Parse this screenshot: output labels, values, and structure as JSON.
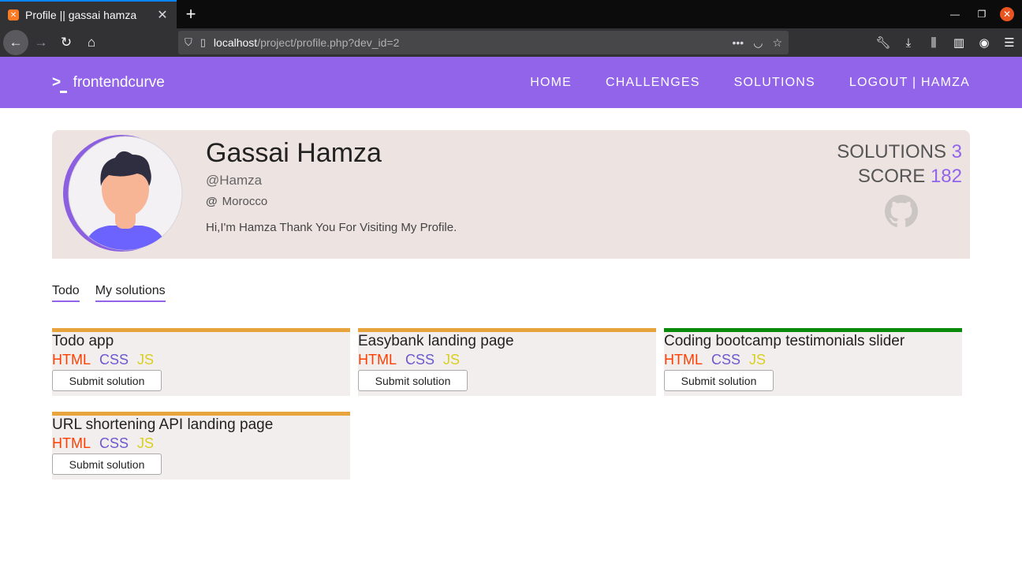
{
  "browser": {
    "tab_title": "Profile || gassai hamza",
    "url_host": "localhost",
    "url_path": "/project/profile.php?dev_id=2"
  },
  "site": {
    "logo_text": "frontendcurve",
    "menu": [
      "HOME",
      "CHALLENGES",
      "SOLUTIONS",
      "LOGOUT | HAMZA"
    ]
  },
  "profile": {
    "name": "Gassai Hamza",
    "handle": "@Hamza",
    "location": "Morocco",
    "bio": "Hi,I'm Hamza Thank You For Visiting My Profile.",
    "solutions_label": "SOLUTIONS",
    "solutions_count": "3",
    "score_label": "SCORE",
    "score_value": "182"
  },
  "tabs": [
    "Todo",
    "My solutions"
  ],
  "challenges": [
    {
      "title": "Todo app",
      "tags": [
        "HTML",
        "CSS",
        "JS"
      ],
      "button": "Submit solution"
    },
    {
      "title": "Easybank landing page",
      "tags": [
        "HTML",
        "CSS",
        "JS"
      ],
      "button": "Submit solution"
    },
    {
      "title": "Coding bootcamp testimonials slider",
      "tags": [
        "HTML",
        "CSS",
        "JS"
      ],
      "button": "Submit solution"
    },
    {
      "title": "URL shortening API landing page",
      "tags": [
        "HTML",
        "CSS",
        "JS"
      ],
      "button": "Submit solution"
    }
  ],
  "colors": {
    "brand": "#9164e9",
    "card_orange": "#e7a33c",
    "card_green": "#0a8a0a"
  }
}
